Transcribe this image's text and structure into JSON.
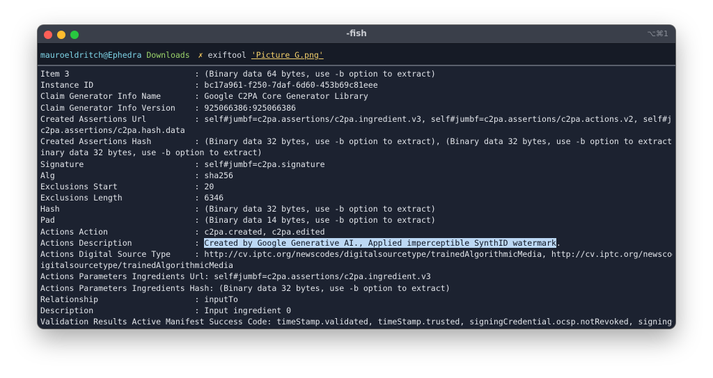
{
  "window": {
    "title": "-fish",
    "shortcut": "⌥⌘1"
  },
  "prompt": {
    "user_host": "mauroeldritch@Ephedra",
    "cwd": "Downloads",
    "marker": "✗",
    "command": "exiftool",
    "argument": "'Picture G.png'"
  },
  "output": [
    "Item 3                          : (Binary data 64 bytes, use -b option to extract)",
    "Instance ID                     : bc17a961-f250-7daf-6d60-453b69c81eee",
    "Claim Generator Info Name       : Google C2PA Core Generator Library",
    "Claim Generator Info Version    : 925066386:925066386",
    "Created Assertions Url          : self#jumbf=c2pa.assertions/c2pa.ingredient.v3, self#jumbf=c2pa.assertions/c2pa.actions.v2, self#jumbf=",
    "c2pa.assertions/c2pa.hash.data",
    "Created Assertions Hash         : (Binary data 32 bytes, use -b option to extract), (Binary data 32 bytes, use -b option to extract), (B",
    "inary data 32 bytes, use -b option to extract)",
    "Signature                       : self#jumbf=c2pa.signature",
    "Alg                             : sha256",
    "Exclusions Start                : 20",
    "Exclusions Length               : 6346",
    "Hash                            : (Binary data 32 bytes, use -b option to extract)",
    "Pad                             : (Binary data 14 bytes, use -b option to extract)",
    "Actions Action                  : c2pa.created, c2pa.edited",
    "Actions Description             : ",
    "Actions Digital Source Type     : http://cv.iptc.org/newscodes/digitalsourcetype/trainedAlgorithmicMedia, http://cv.iptc.org/newscodes/d",
    "igitalsourcetype/trainedAlgorithmicMedia",
    "Actions Parameters Ingredients Url: self#jumbf=c2pa.assertions/c2pa.ingredient.v3",
    "Actions Parameters Ingredients Hash: (Binary data 32 bytes, use -b option to extract)",
    "Relationship                    : inputTo",
    "Description                     : Input ingredient 0",
    "Validation Results Active Manifest Success Code: timeStamp.validated, timeStamp.trusted, signingCredential.ocsp.notRevoked, signingCrede"
  ],
  "highlighted": {
    "text": "Created by Google Generative AI., Applied imperceptible SynthID watermark",
    "trailing": ".",
    "color": "#bcd8f4"
  }
}
